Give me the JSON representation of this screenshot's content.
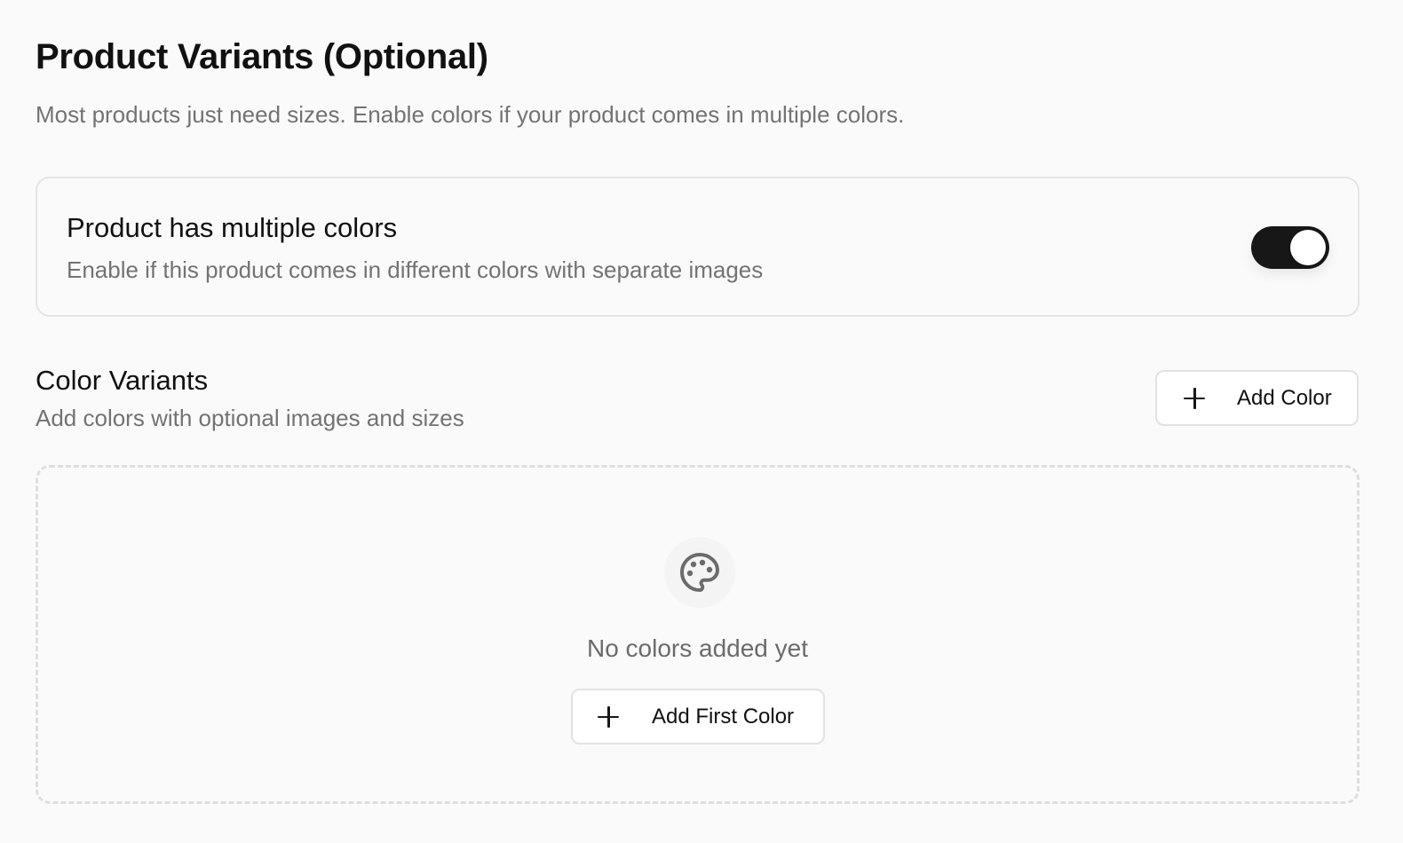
{
  "header": {
    "title": "Product Variants (Optional)",
    "subtitle": "Most products just need sizes. Enable colors if your product comes in multiple colors."
  },
  "multi_color_toggle": {
    "title": "Product has multiple colors",
    "description": "Enable if this product comes in different colors with separate images",
    "enabled": true,
    "track_color": "#171717",
    "knob_color": "#ffffff"
  },
  "color_variants": {
    "title": "Color Variants",
    "description": "Add colors with optional images and sizes",
    "add_button_label": "Add Color",
    "add_button_icon": "plus-icon",
    "empty_state": {
      "icon": "palette-icon",
      "message": "No colors added yet",
      "button_label": "Add First Color",
      "button_icon": "plus-icon"
    }
  }
}
